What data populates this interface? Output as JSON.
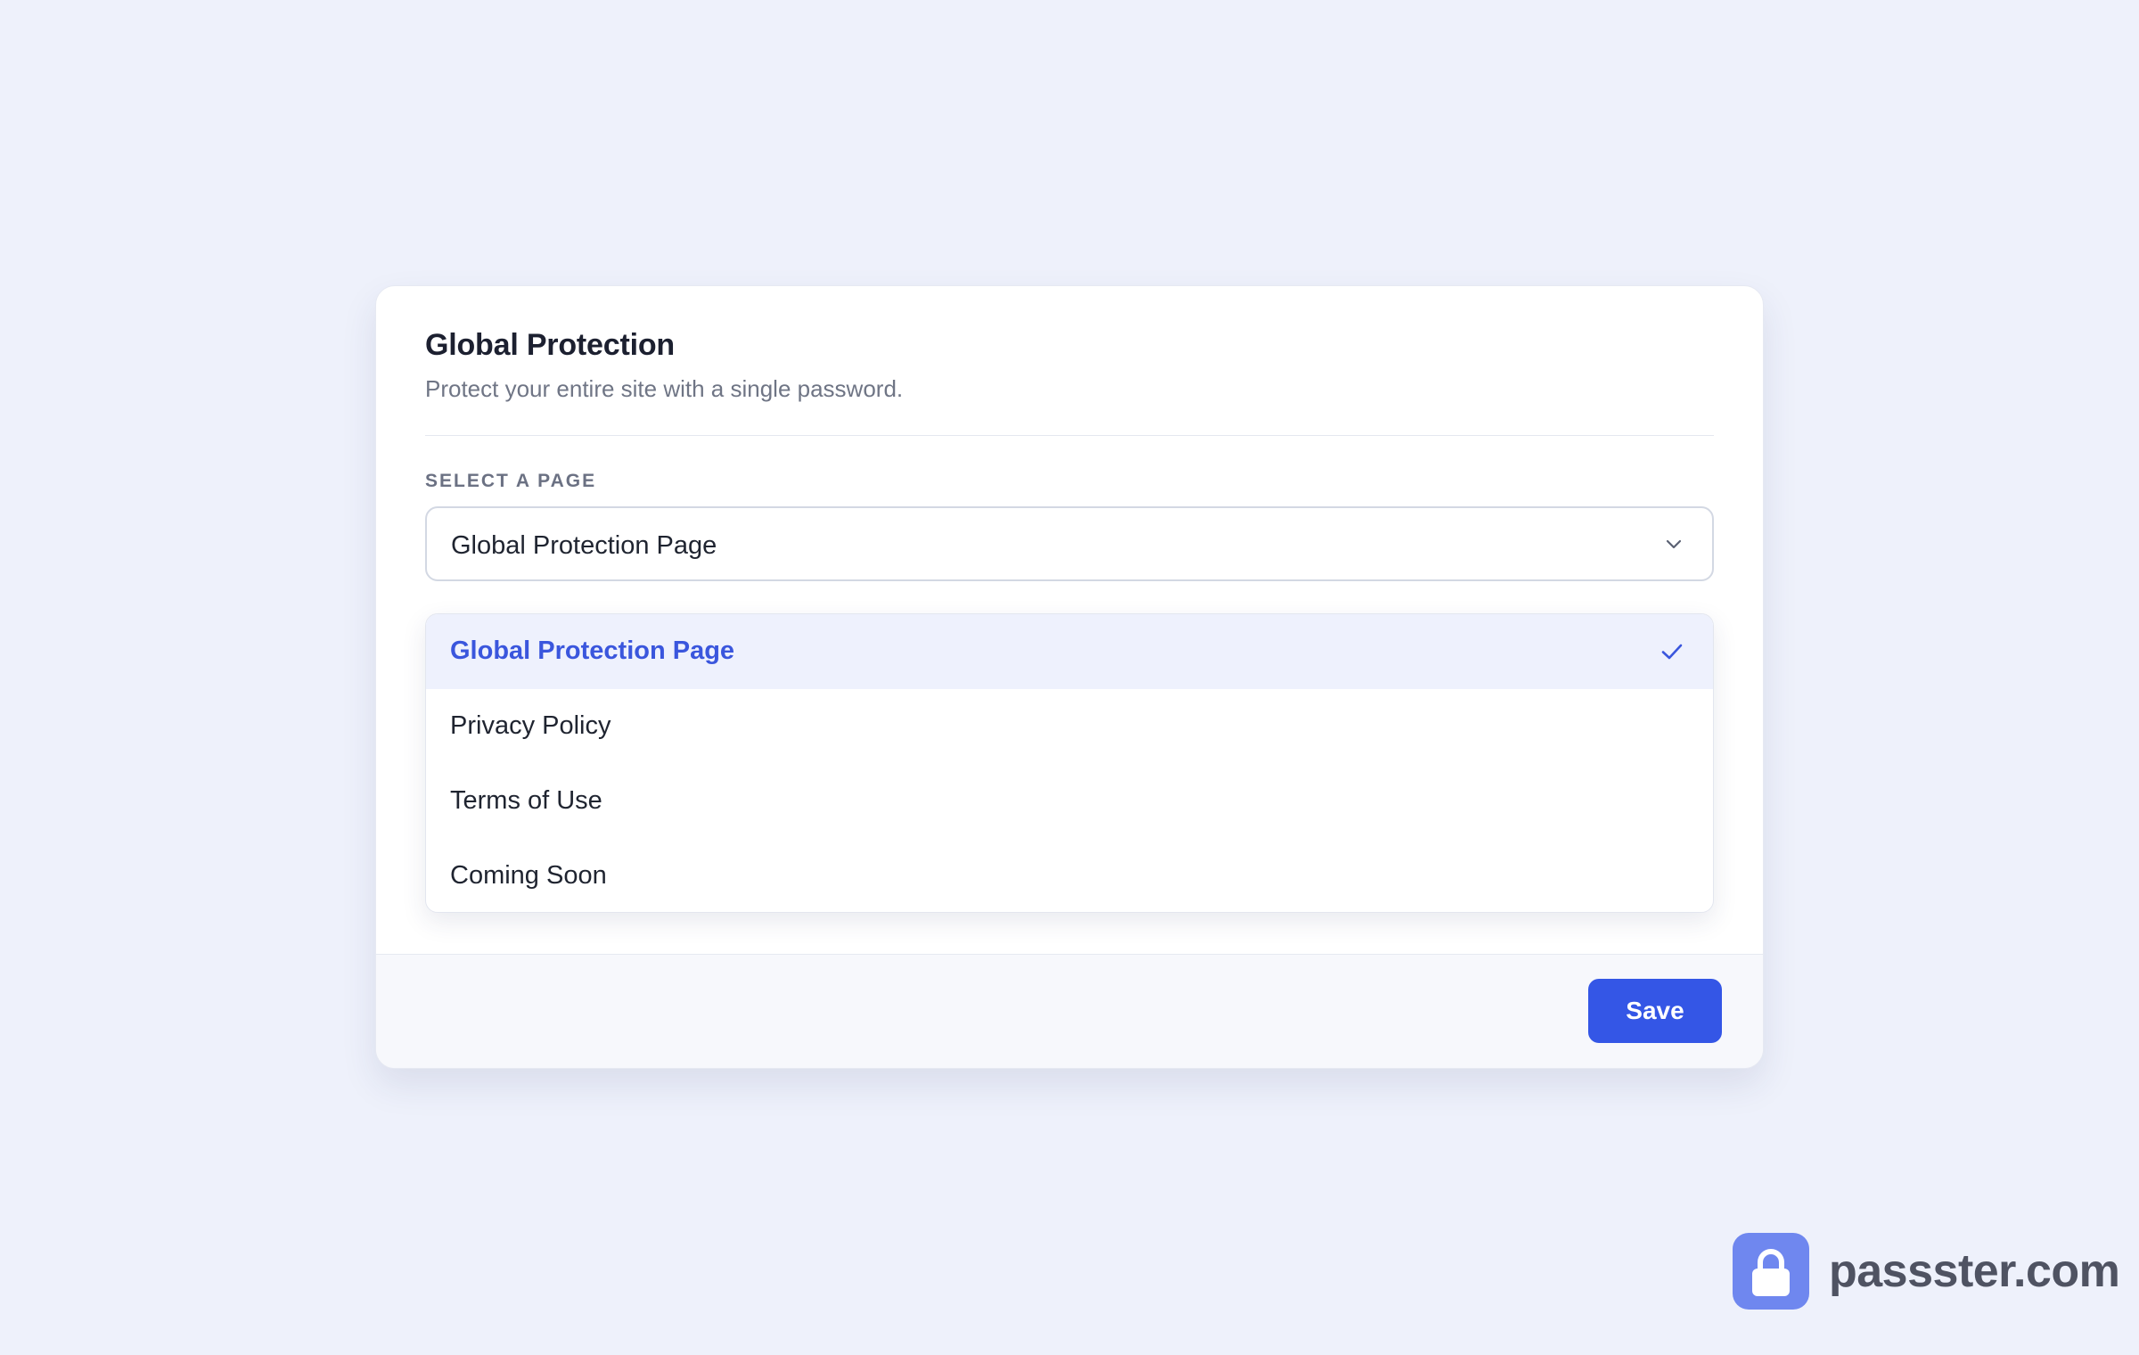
{
  "card": {
    "title": "Global Protection",
    "subtitle": "Protect your entire site with a single password."
  },
  "field": {
    "label": "SELECT A PAGE",
    "selected_value": "Global Protection Page"
  },
  "dropdown": {
    "options": [
      {
        "label": "Global Protection Page",
        "selected": true
      },
      {
        "label": "Privacy Policy",
        "selected": false
      },
      {
        "label": "Terms of Use",
        "selected": false
      },
      {
        "label": "Coming Soon",
        "selected": false
      }
    ]
  },
  "footer": {
    "save_label": "Save"
  },
  "brand": {
    "name": "passster.com",
    "logo_icon": "lock-icon"
  },
  "colors": {
    "accent": "#3456e6",
    "selected_text": "#3a56dd",
    "selected_background": "#eef1fd",
    "page_background": "#eef1fb",
    "brand_logo": "#6f87ef"
  },
  "icons": {
    "select_chevron": "chevron-down-icon",
    "selected_check": "check-icon"
  }
}
